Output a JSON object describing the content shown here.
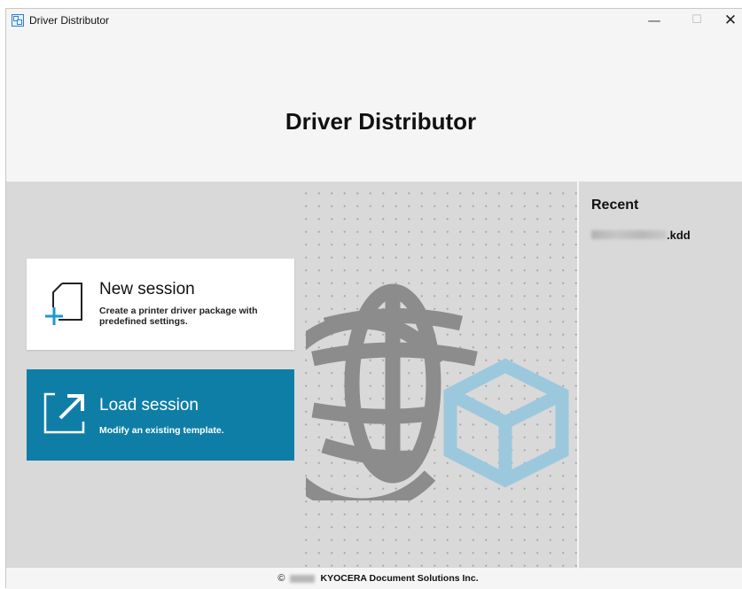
{
  "window": {
    "title": "Driver Distributor",
    "minimize": "—",
    "maximize": "☐",
    "close": "✕"
  },
  "header": {
    "title": "Driver Distributor"
  },
  "new_session": {
    "title": "New session",
    "description": "Create a printer driver package with predefined settings."
  },
  "load_session": {
    "title": "Load session",
    "description": "Modify an existing template."
  },
  "recent": {
    "heading": "Recent",
    "item_extension": ".kdd"
  },
  "footer": {
    "copyright_symbol": "©",
    "company": "KYOCERA Document Solutions Inc."
  },
  "colors": {
    "accent": "#0f7ea6",
    "panel": "#d9d9d9",
    "background": "#f5f5f5",
    "globe": "#8c8c8c",
    "box": "#9cc8dd"
  },
  "icons": [
    "app-icon",
    "new-document-icon",
    "open-file-icon",
    "globe-icon",
    "package-box-icon"
  ]
}
